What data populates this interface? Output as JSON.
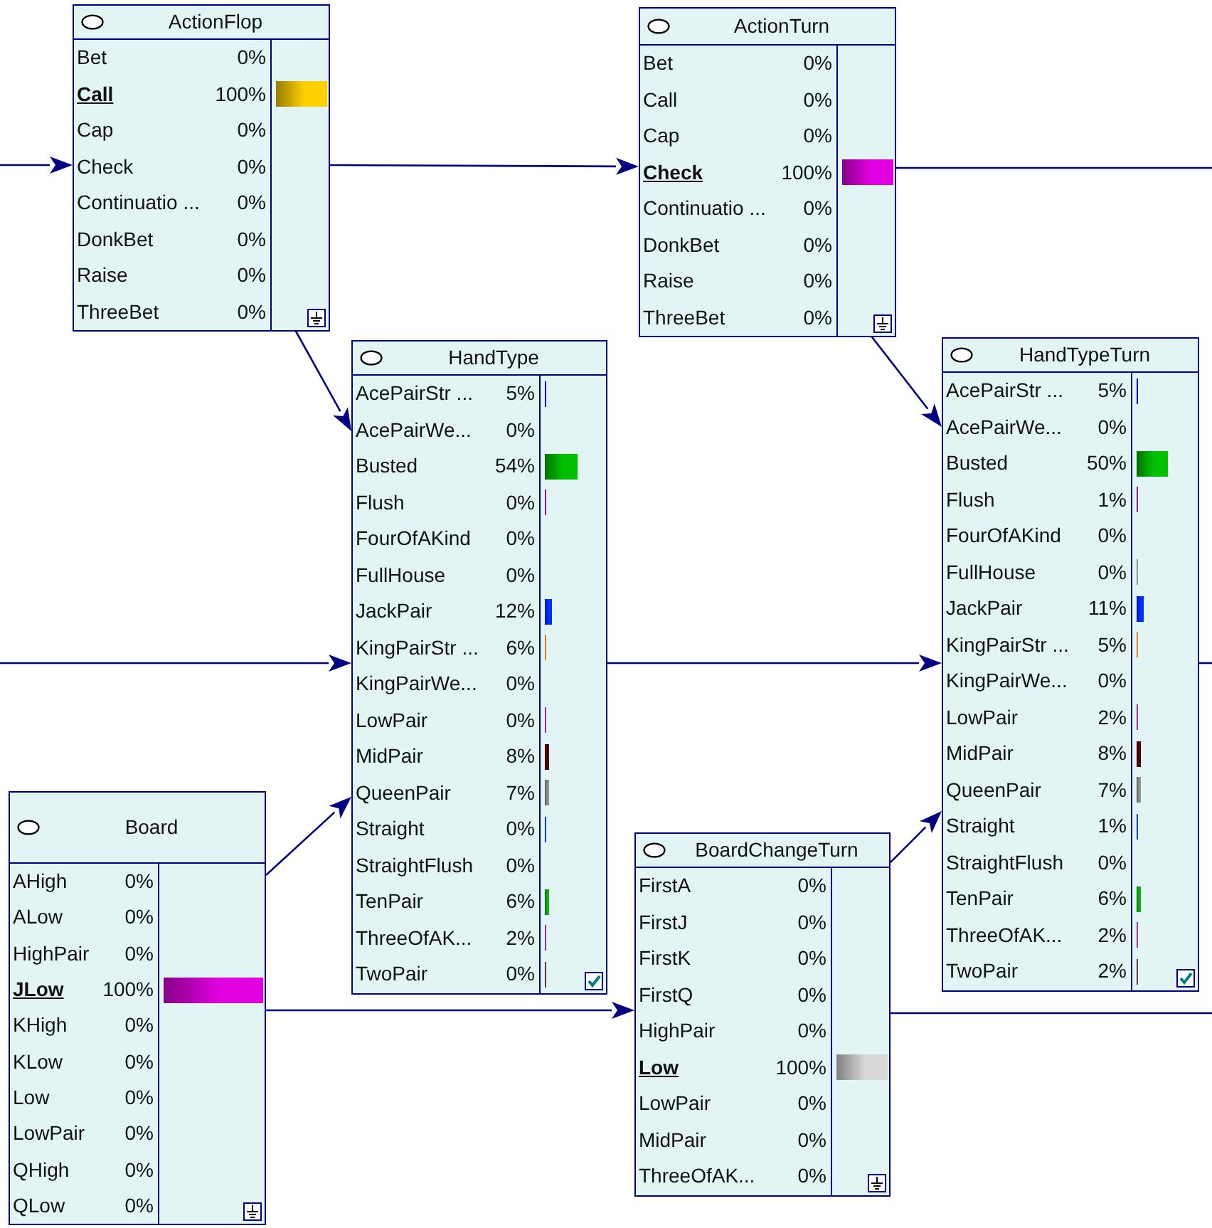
{
  "nodes": [
    {
      "title": "ActionFlop",
      "kind": "ground",
      "states": [
        {
          "label": "Bet",
          "value": "0%",
          "evidence": false
        },
        {
          "label": "Call",
          "value": "100%",
          "color": "#ffd000",
          "evidence": true
        },
        {
          "label": "Cap",
          "value": "0%",
          "evidence": false
        },
        {
          "label": "Check",
          "value": "0%",
          "evidence": false
        },
        {
          "label": "Continuatio ...",
          "value": "0%",
          "evidence": false
        },
        {
          "label": "DonkBet",
          "value": "0%",
          "evidence": false
        },
        {
          "label": "Raise",
          "value": "0%",
          "evidence": false
        },
        {
          "label": "ThreeBet",
          "value": "0%",
          "evidence": false
        }
      ]
    },
    {
      "title": "ActionTurn",
      "kind": "ground",
      "states": [
        {
          "label": "Bet",
          "value": "0%",
          "evidence": false
        },
        {
          "label": "Call",
          "value": "0%",
          "evidence": false
        },
        {
          "label": "Cap",
          "value": "0%",
          "evidence": false
        },
        {
          "label": "Check",
          "value": "100%",
          "color": "#e000e0",
          "evidence": true
        },
        {
          "label": "Continuatio ...",
          "value": "0%",
          "evidence": false
        },
        {
          "label": "DonkBet",
          "value": "0%",
          "evidence": false
        },
        {
          "label": "Raise",
          "value": "0%",
          "evidence": false
        },
        {
          "label": "ThreeBet",
          "value": "0%",
          "evidence": false
        }
      ]
    },
    {
      "title": "HandType",
      "kind": "check",
      "states": [
        {
          "label": "AcePairStr ...",
          "value": "5%",
          "color": "#0000ff",
          "evidence": false
        },
        {
          "label": "AcePairWe...",
          "value": "0%",
          "evidence": false
        },
        {
          "label": "Busted",
          "value": "54%",
          "color": "#00c000",
          "evidence": false
        },
        {
          "label": "Flush",
          "value": "0%",
          "color": "#a020a0",
          "evidence": false
        },
        {
          "label": "FourOfAKind",
          "value": "0%",
          "evidence": false
        },
        {
          "label": "FullHouse",
          "value": "0%",
          "evidence": false
        },
        {
          "label": "JackPair",
          "value": "12%",
          "color": "#0030ff",
          "evidence": false
        },
        {
          "label": "KingPairStr ...",
          "value": "6%",
          "color": "#ff9020",
          "evidence": false
        },
        {
          "label": "KingPairWe...",
          "value": "0%",
          "evidence": false
        },
        {
          "label": "LowPair",
          "value": "0%",
          "color": "#b030a0",
          "evidence": false
        },
        {
          "label": "MidPair",
          "value": "8%",
          "color": "#500000",
          "evidence": false
        },
        {
          "label": "QueenPair",
          "value": "7%",
          "color": "#909090",
          "evidence": false
        },
        {
          "label": "Straight",
          "value": "0%",
          "color": "#2040ff",
          "evidence": false
        },
        {
          "label": "StraightFlush",
          "value": "0%",
          "evidence": false
        },
        {
          "label": "TenPair",
          "value": "6%",
          "color": "#10b010",
          "evidence": false
        },
        {
          "label": "ThreeOfAK...",
          "value": "2%",
          "color": "#a040a0",
          "evidence": false
        },
        {
          "label": "TwoPair",
          "value": "0%",
          "color": "#704040",
          "evidence": false
        }
      ]
    },
    {
      "title": "HandTypeTurn",
      "kind": "check",
      "states": [
        {
          "label": "AcePairStr ...",
          "value": "5%",
          "color": "#0000ff",
          "evidence": false
        },
        {
          "label": "AcePairWe...",
          "value": "0%",
          "evidence": false
        },
        {
          "label": "Busted",
          "value": "50%",
          "color": "#00c000",
          "evidence": false
        },
        {
          "label": "Flush",
          "value": "1%",
          "color": "#a020a0",
          "evidence": false
        },
        {
          "label": "FourOfAKind",
          "value": "0%",
          "evidence": false
        },
        {
          "label": "FullHouse",
          "value": "0%",
          "color": "#a0a0a0",
          "evidence": false
        },
        {
          "label": "JackPair",
          "value": "11%",
          "color": "#0030ff",
          "evidence": false
        },
        {
          "label": "KingPairStr ...",
          "value": "5%",
          "color": "#ff9020",
          "evidence": false
        },
        {
          "label": "KingPairWe...",
          "value": "0%",
          "evidence": false
        },
        {
          "label": "LowPair",
          "value": "2%",
          "color": "#b030a0",
          "evidence": false
        },
        {
          "label": "MidPair",
          "value": "8%",
          "color": "#500000",
          "evidence": false
        },
        {
          "label": "QueenPair",
          "value": "7%",
          "color": "#909090",
          "evidence": false
        },
        {
          "label": "Straight",
          "value": "1%",
          "color": "#2040ff",
          "evidence": false
        },
        {
          "label": "StraightFlush",
          "value": "0%",
          "evidence": false
        },
        {
          "label": "TenPair",
          "value": "6%",
          "color": "#10b010",
          "evidence": false
        },
        {
          "label": "ThreeOfAK...",
          "value": "2%",
          "color": "#a040a0",
          "evidence": false
        },
        {
          "label": "TwoPair",
          "value": "2%",
          "color": "#704040",
          "evidence": false
        }
      ]
    },
    {
      "title": "Board",
      "kind": "ground",
      "states": [
        {
          "label": "AHigh",
          "value": "0%",
          "evidence": false
        },
        {
          "label": "ALow",
          "value": "0%",
          "evidence": false
        },
        {
          "label": "HighPair",
          "value": "0%",
          "evidence": false
        },
        {
          "label": "JLow",
          "value": "100%",
          "color": "#e000e0",
          "evidence": true
        },
        {
          "label": "KHigh",
          "value": "0%",
          "evidence": false
        },
        {
          "label": "KLow",
          "value": "0%",
          "evidence": false
        },
        {
          "label": "Low",
          "value": "0%",
          "evidence": false
        },
        {
          "label": "LowPair",
          "value": "0%",
          "evidence": false
        },
        {
          "label": "QHigh",
          "value": "0%",
          "evidence": false
        },
        {
          "label": "QLow",
          "value": "0%",
          "evidence": false
        }
      ]
    },
    {
      "title": "BoardChangeTurn",
      "kind": "ground",
      "states": [
        {
          "label": "FirstA",
          "value": "0%",
          "evidence": false
        },
        {
          "label": "FirstJ",
          "value": "0%",
          "evidence": false
        },
        {
          "label": "FirstK",
          "value": "0%",
          "evidence": false
        },
        {
          "label": "FirstQ",
          "value": "0%",
          "evidence": false
        },
        {
          "label": "HighPair",
          "value": "0%",
          "evidence": false
        },
        {
          "label": "Low",
          "value": "100%",
          "color": "#d8d8d8",
          "evidence": true
        },
        {
          "label": "LowPair",
          "value": "0%",
          "evidence": false
        },
        {
          "label": "MidPair",
          "value": "0%",
          "evidence": false
        },
        {
          "label": "ThreeOfAK...",
          "value": "0%",
          "evidence": false
        }
      ]
    }
  ]
}
